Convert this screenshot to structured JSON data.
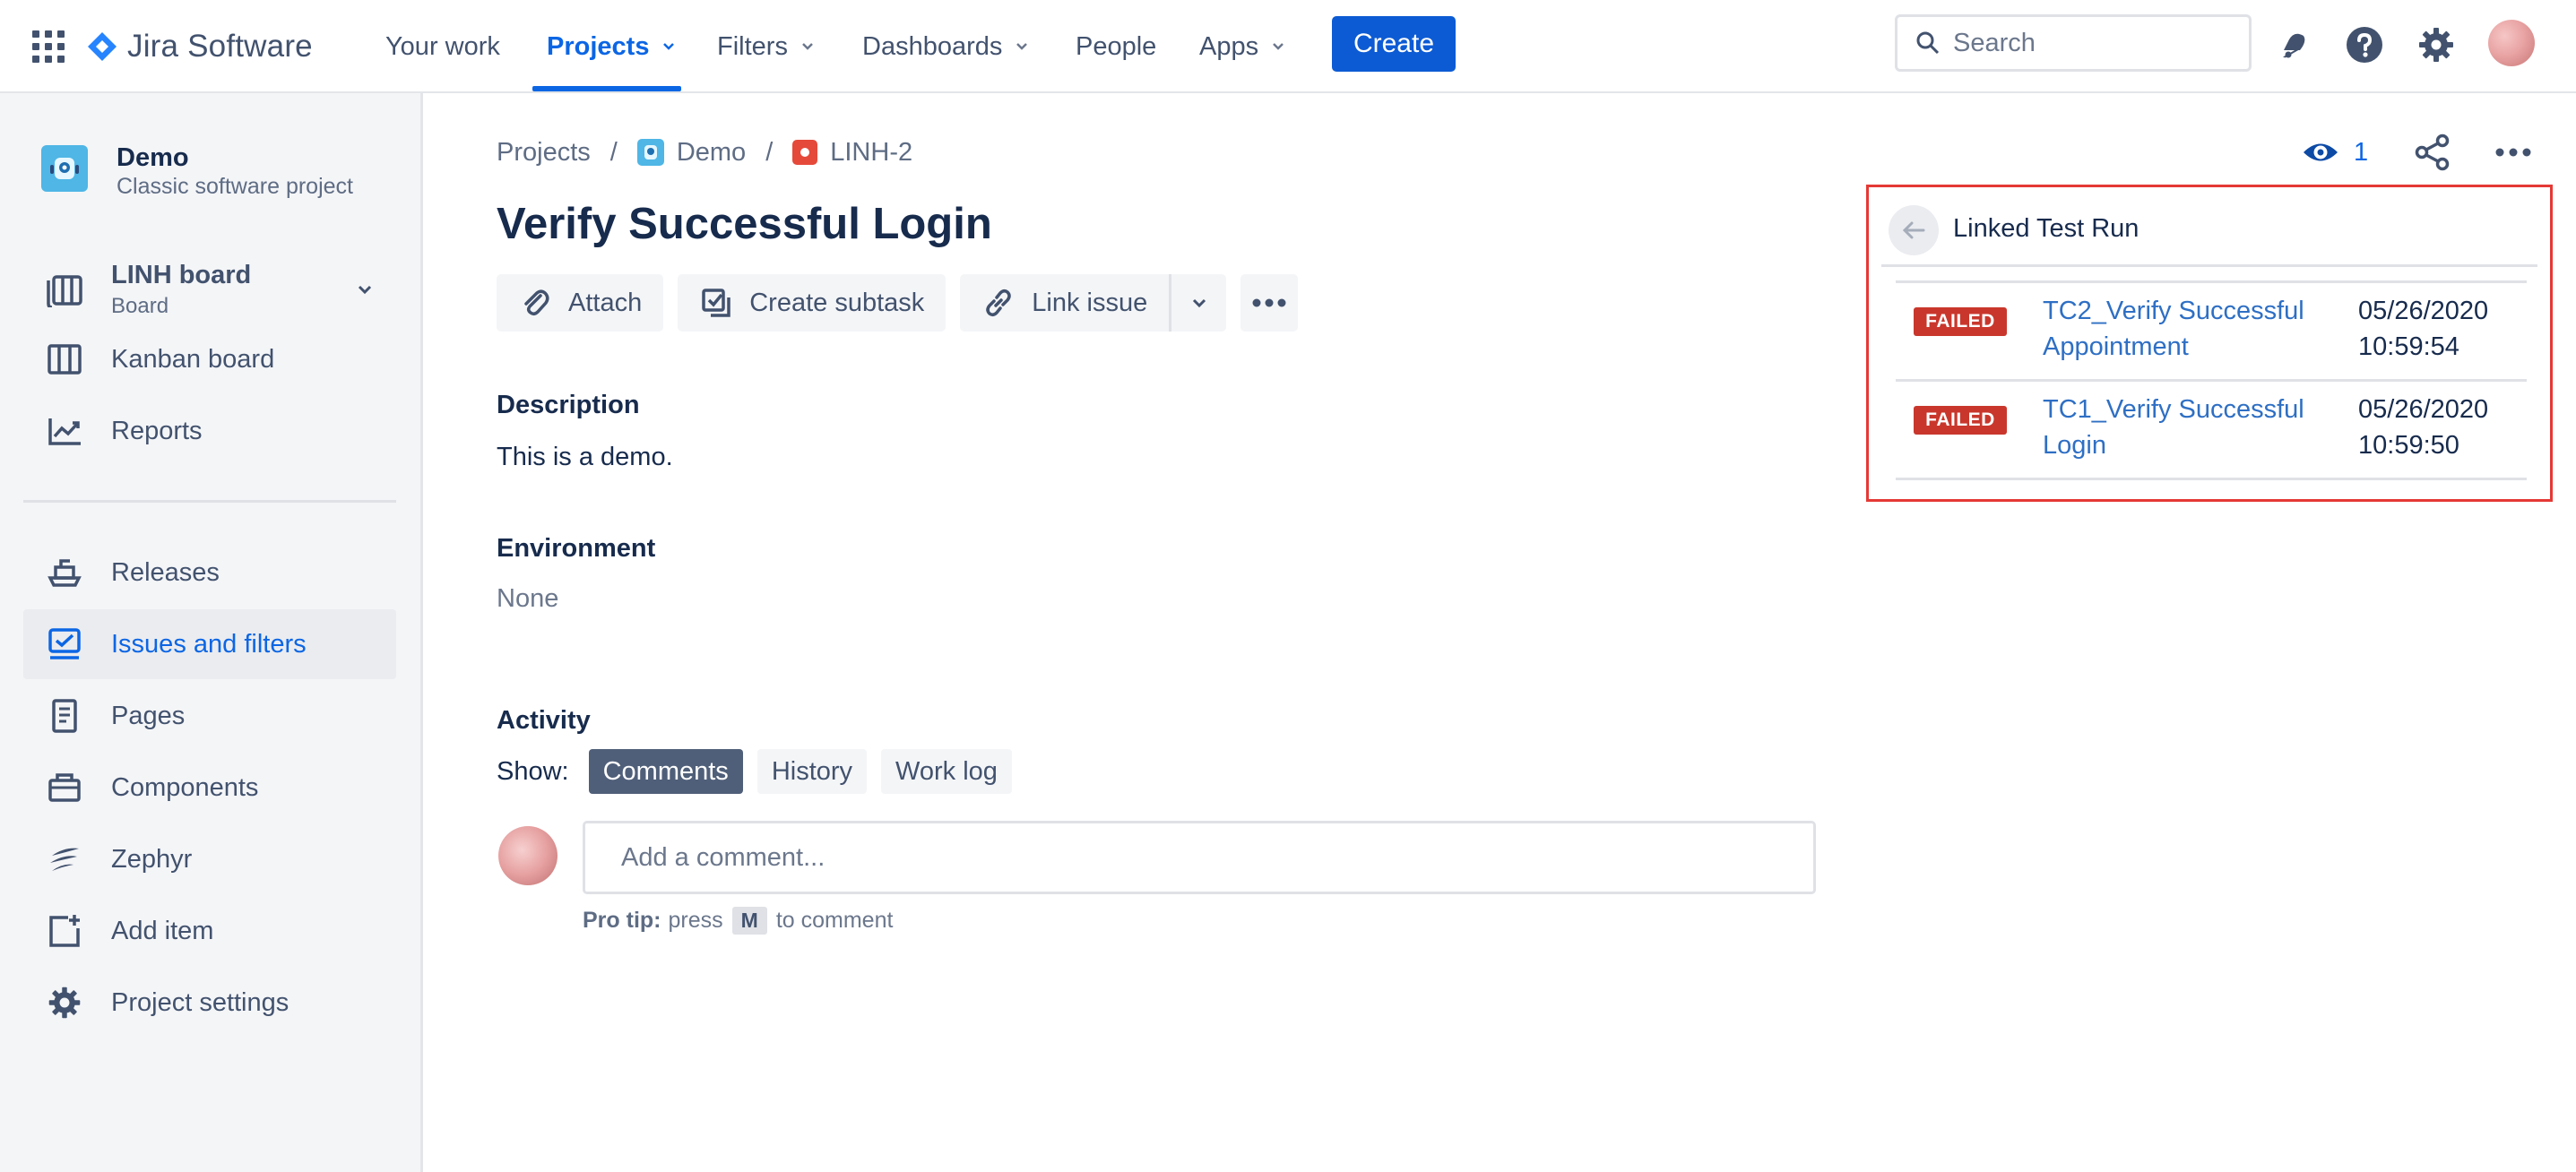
{
  "app": {
    "product_name": "Jira Software",
    "colors": {
      "accent": "#0c66e4",
      "failed": "#c9372c",
      "highlight_border": "#e53935"
    }
  },
  "topnav": {
    "items": [
      {
        "label": "Your work",
        "has_dropdown": false
      },
      {
        "label": "Projects",
        "has_dropdown": true,
        "active": true
      },
      {
        "label": "Filters",
        "has_dropdown": true
      },
      {
        "label": "Dashboards",
        "has_dropdown": true
      },
      {
        "label": "People",
        "has_dropdown": false
      },
      {
        "label": "Apps",
        "has_dropdown": true
      }
    ],
    "create_label": "Create",
    "search_placeholder": "Search",
    "icons": [
      "notifications-icon",
      "help-icon",
      "settings-icon",
      "avatar"
    ]
  },
  "sidebar": {
    "project": {
      "name": "Demo",
      "type": "Classic software project"
    },
    "board": {
      "title": "LINH board",
      "subtitle": "Board"
    },
    "items_top": [
      {
        "label": "Kanban board",
        "icon": "kanban-icon"
      },
      {
        "label": "Reports",
        "icon": "reports-icon"
      }
    ],
    "items_bottom": [
      {
        "label": "Releases",
        "icon": "releases-icon"
      },
      {
        "label": "Issues and filters",
        "icon": "issues-icon",
        "selected": true
      },
      {
        "label": "Pages",
        "icon": "pages-icon"
      },
      {
        "label": "Components",
        "icon": "components-icon"
      },
      {
        "label": "Zephyr",
        "icon": "zephyr-icon"
      },
      {
        "label": "Add item",
        "icon": "add-item-icon"
      },
      {
        "label": "Project settings",
        "icon": "settings-icon"
      }
    ]
  },
  "breadcrumb": [
    "Projects",
    "Demo",
    "LINH-2"
  ],
  "issue": {
    "title": "Verify Successful Login",
    "actions": [
      "Attach",
      "Create subtask",
      "Link issue"
    ],
    "description_label": "Description",
    "description": "This is a demo.",
    "environment_label": "Environment",
    "environment": "None",
    "activity_label": "Activity",
    "show_label": "Show:",
    "activity_tabs": [
      {
        "label": "Comments",
        "active": true
      },
      {
        "label": "History",
        "active": false
      },
      {
        "label": "Work log",
        "active": false
      }
    ],
    "comment_placeholder": "Add a comment...",
    "tip": {
      "prefix": "Pro tip:",
      "text1": "press",
      "key": "M",
      "text2": "to comment"
    },
    "watchers": "1"
  },
  "linked_test_run": {
    "title": "Linked Test Run",
    "runs": [
      {
        "status": "FAILED",
        "name_line1": "TC2_Verify Successful",
        "name_line2": "Appointment",
        "date": "05/26/2020",
        "time": "10:59:54"
      },
      {
        "status": "FAILED",
        "name_line1": "TC1_Verify Successful",
        "name_line2": "Login",
        "date": "05/26/2020",
        "time": "10:59:50"
      }
    ]
  }
}
